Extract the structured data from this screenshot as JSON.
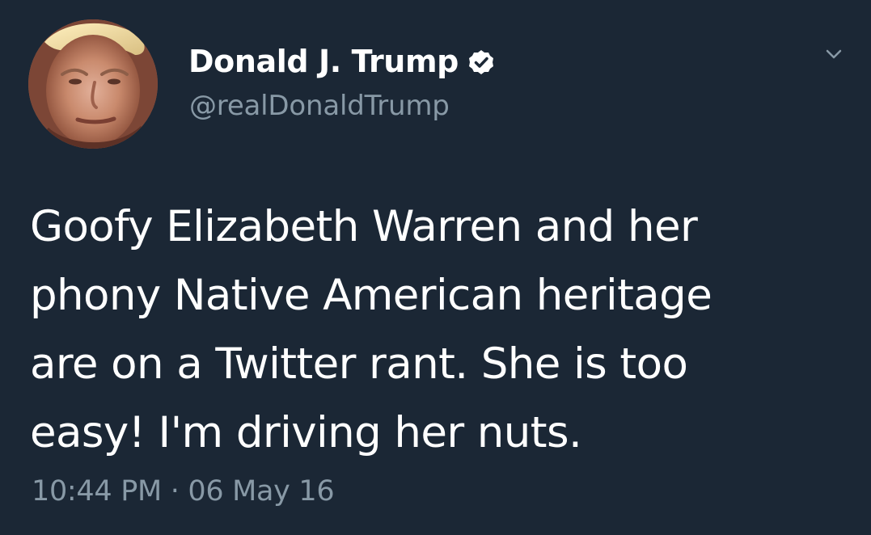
{
  "tweet": {
    "display_name": "Donald J. Trump",
    "handle": "@realDonaldTrump",
    "text": "Goofy Elizabeth Warren and her\nphony Native American heritage\nare on a Twitter rant. She is too\neasy! I'm driving her nuts.",
    "timestamp": "10:44 PM · 06 May 16",
    "verified": true,
    "icons": {
      "avatar": "profile-photo",
      "verified": "verified-badge-icon",
      "menu": "chevron-down-icon"
    }
  },
  "colors": {
    "background": "#1b2735",
    "primary_text": "#ffffff",
    "secondary_text": "#8899a6"
  }
}
